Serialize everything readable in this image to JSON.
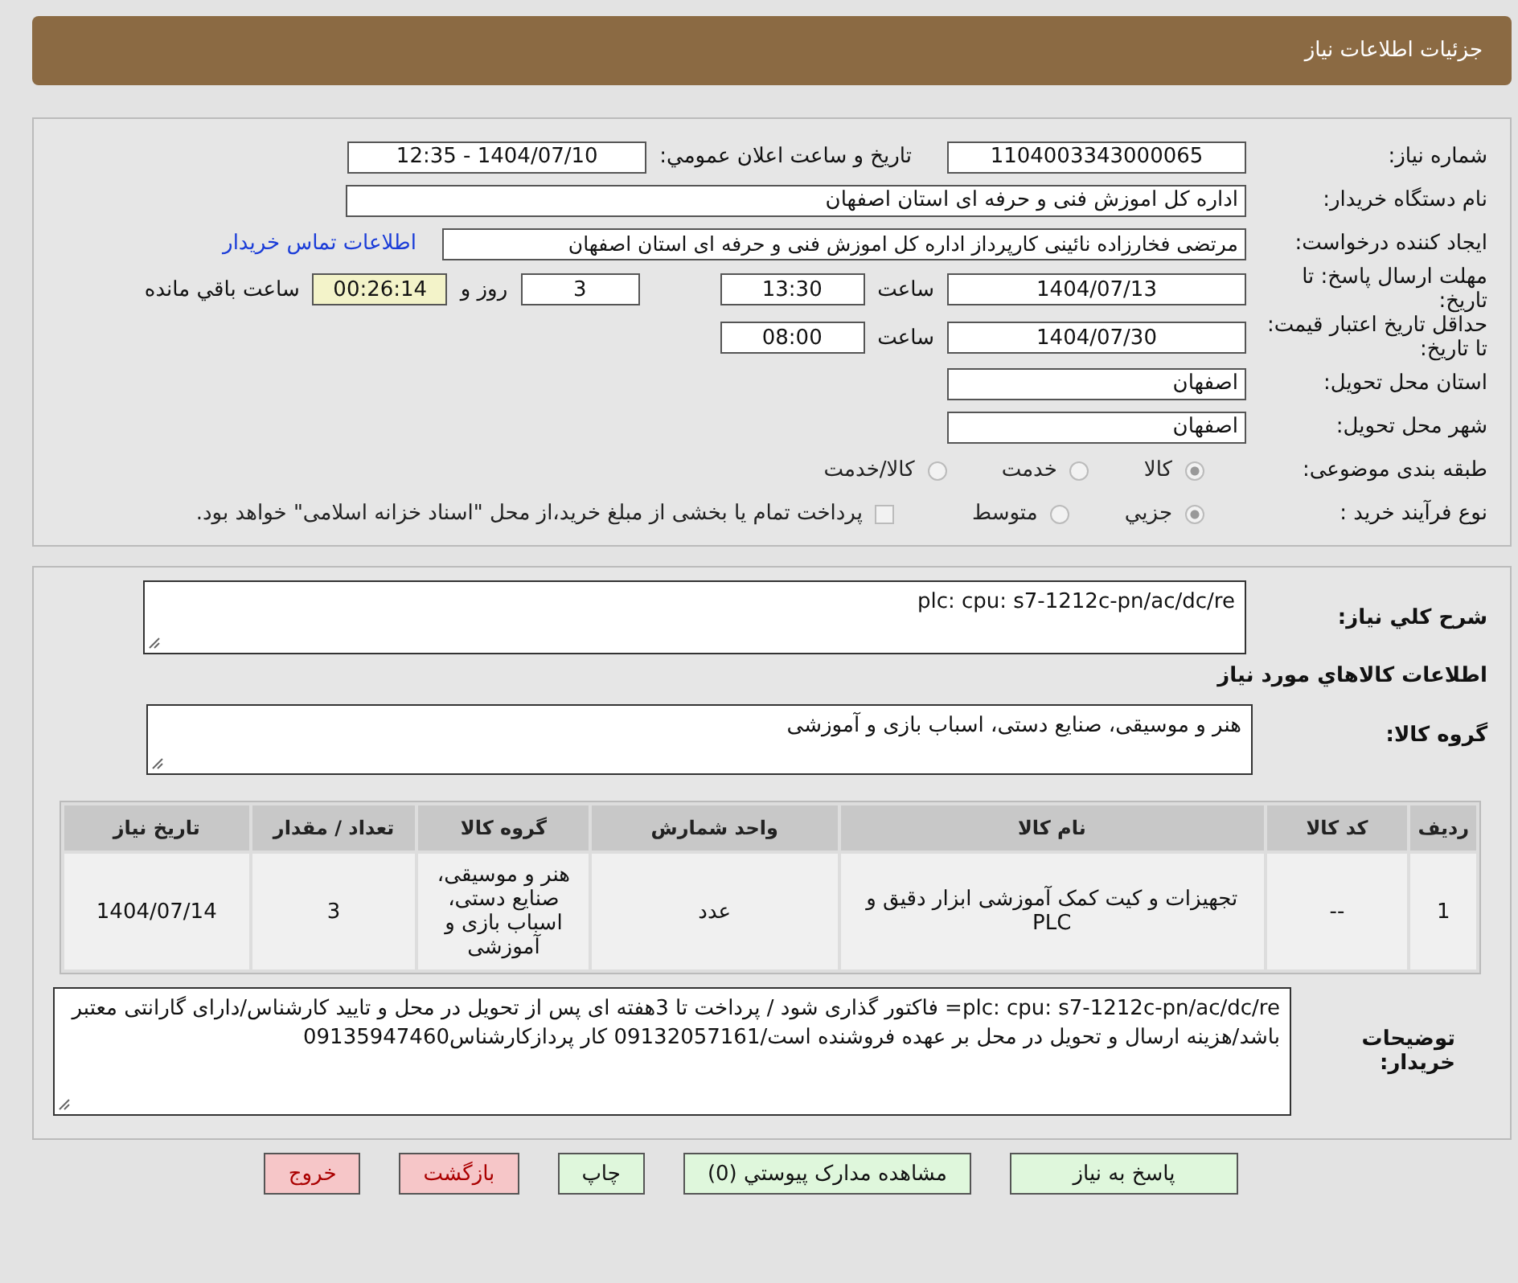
{
  "header": {
    "title": "جزئیات اطلاعات نیاز"
  },
  "need_number": {
    "label": "شماره نیاز:",
    "value": "1104003343000065"
  },
  "announce": {
    "label": "تاریخ و ساعت اعلان عمومي:",
    "value": "1404/07/10 - 12:35"
  },
  "buyer": {
    "label": "نام دستگاه خریدار:",
    "value": "اداره کل اموزش فنی و حرفه ای استان اصفهان"
  },
  "requester": {
    "label": "ایجاد کننده درخواست:",
    "value": "مرتضی فخارزاده نائینی کارپرداز اداره کل اموزش فنی و حرفه ای استان اصفهان",
    "contact_link": "اطلاعات تماس خریدار"
  },
  "deadline": {
    "label": "مهلت ارسال پاسخ: تا تاریخ:",
    "date": "1404/07/13",
    "time_label": "ساعت",
    "time": "13:30",
    "days": "3",
    "days_label": "روز و",
    "remaining": "00:26:14",
    "remaining_label": "ساعت باقي مانده"
  },
  "validity": {
    "label": "حداقل تاریخ اعتبار قیمت: تا تاریخ:",
    "date": "1404/07/30",
    "time_label": "ساعت",
    "time": "08:00"
  },
  "province": {
    "label": "استان محل تحویل:",
    "value": "اصفهان"
  },
  "city": {
    "label": "شهر محل تحویل:",
    "value": "اصفهان"
  },
  "category": {
    "label": "طبقه بندی موضوعی:",
    "options": [
      {
        "label": "کالا",
        "selected": true
      },
      {
        "label": "خدمت",
        "selected": false
      },
      {
        "label": "کالا/خدمت",
        "selected": false
      }
    ]
  },
  "process": {
    "label": "نوع فرآیند خرید :",
    "options": [
      {
        "label": "جزيي",
        "selected": true
      },
      {
        "label": "متوسط",
        "selected": false
      }
    ],
    "payment": {
      "label": "پرداخت تمام یا بخشی از مبلغ خرید،از محل \"اسناد خزانه اسلامی\" خواهد بود.",
      "checked": false
    }
  },
  "summary": {
    "label": "شرح کلي نیاز:",
    "value": "plc: cpu: s7-1212c-pn/ac/dc/re"
  },
  "goods_title": "اطلاعات کالاهاي مورد نياز",
  "goods_group": {
    "label": "گروه کالا:",
    "value": "هنر و موسیقی، صنایع دستی، اسباب بازی و آموزشی"
  },
  "table": {
    "columns": [
      "ردیف",
      "کد کالا",
      "نام کالا",
      "واحد شمارش",
      "گروه کالا",
      "تعداد / مقدار",
      "تاریخ نیاز"
    ],
    "rows": [
      [
        "1",
        "--",
        "تجهیزات و کیت کمک آموزشی ابزار دقیق و PLC",
        "عدد",
        "هنر و موسیقی، صنایع دستی، اسباب بازی و آموزشی",
        "3",
        "1404/07/14"
      ]
    ]
  },
  "buyer_notes": {
    "label": "توضیحات خریدار:",
    "value": "plc: cpu: s7-1212c-pn/ac/dc/re= فاکتور گذاری شود / پرداخت  تا 3هفته ای پس از تحویل در محل و تایید کارشناس/دارای گارانتی معتبر باشد/هزینه ارسال و تحویل در محل بر عهده فروشنده است/09132057161 کار پردازکارشناس09135947460"
  },
  "buttons": [
    {
      "label": "پاسخ به نیاز",
      "kind": "action"
    },
    {
      "label": "مشاهده مدارک پیوستي (0)",
      "kind": "action"
    },
    {
      "label": "چاپ",
      "kind": "action"
    },
    {
      "label": "بازگشت",
      "kind": "danger"
    },
    {
      "label": "خروج",
      "kind": "danger"
    }
  ]
}
